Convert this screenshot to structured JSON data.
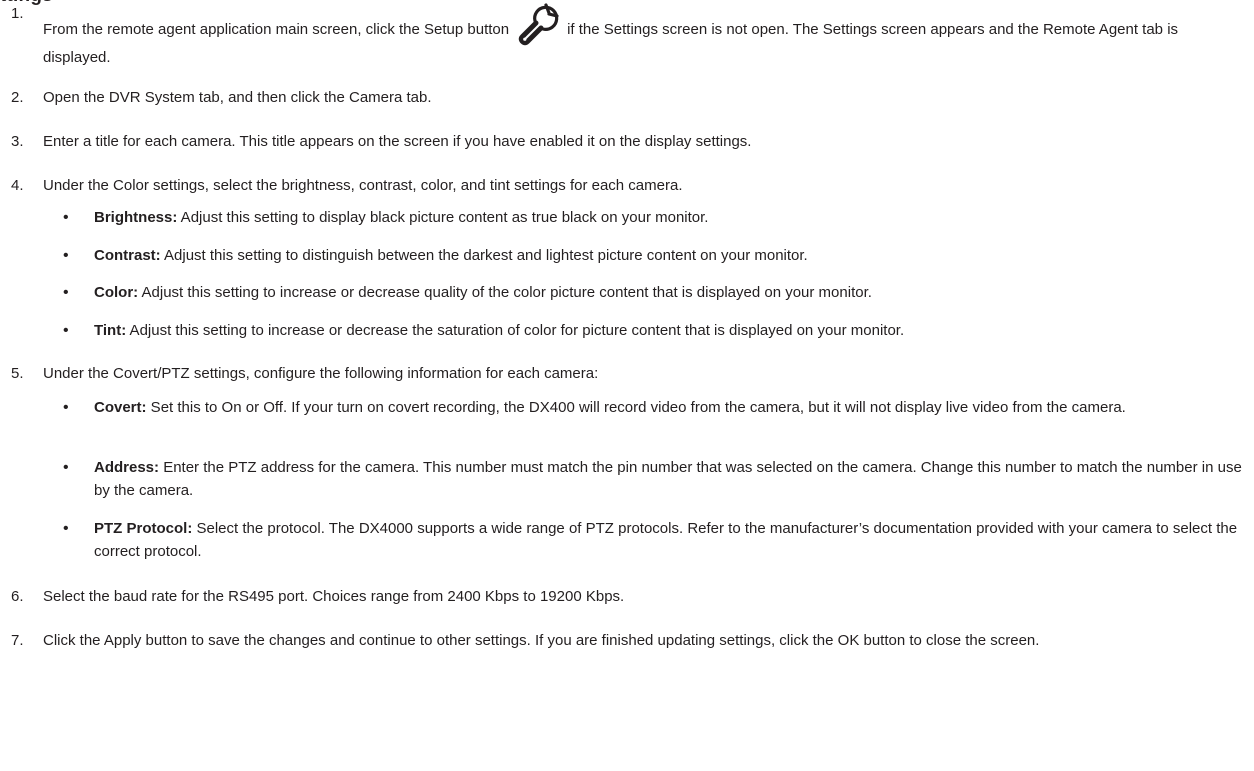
{
  "heading_fragment": "ttings",
  "setup_icon": "wrench-icon",
  "steps": [
    {
      "num": "1.",
      "before_icon": "From the remote agent application main screen, click the Setup button",
      "after_icon": "if the Settings screen is not open. The Settings screen appears and the Remote Agent tab is displayed."
    },
    {
      "num": "2.",
      "text": "Open the DVR System tab, and then click the Camera tab."
    },
    {
      "num": "3.",
      "text": "Enter a title for each camera. This title appears on the screen if you have enabled it on the display settings."
    },
    {
      "num": "4.",
      "text": "Under the Color settings, select the brightness, contrast, color, and tint settings for each camera."
    },
    {
      "num": "5.",
      "text": "Under the Covert/PTZ settings, configure the following information for each camera:"
    },
    {
      "num": "6.",
      "text": "Select the baud rate for the RS495 port. Choices range from 2400 Kbps to 19200 Kbps."
    },
    {
      "num": "7.",
      "text": "Click the Apply button to save the changes and continue to other settings. If you are finished updating settings, click the OK button to close the screen."
    }
  ],
  "color_bullets": [
    {
      "term": "Brightness:",
      "text": " Adjust this setting to display black picture content as true black on your monitor."
    },
    {
      "term": "Contrast:",
      "text": " Adjust this setting to distinguish between the darkest and lightest picture content on your monitor."
    },
    {
      "term": "Color:",
      "text": " Adjust this setting to increase or decrease quality of the color picture content that is displayed on your monitor."
    },
    {
      "term": "Tint:",
      "text": " Adjust this setting to increase or decrease the saturation of color for picture content that is displayed on your monitor."
    }
  ],
  "ptz_bullets": [
    {
      "term": "Covert:",
      "text": " Set this to On or Off. If your turn on covert recording, the DX400 will record video from the camera, but it will not display live video from the camera."
    },
    {
      "term": "Address:",
      "text": " Enter the PTZ address for the camera. This number must match the pin number that was selected on the camera. Change this number to match the number in use by the camera."
    },
    {
      "term": "PTZ Protocol:",
      "text": " Select the protocol. The DX4000 supports a wide range of PTZ protocols. Refer to the manufacturer’s documentation provided with your camera to select the correct protocol."
    }
  ],
  "bullet_char": "•"
}
